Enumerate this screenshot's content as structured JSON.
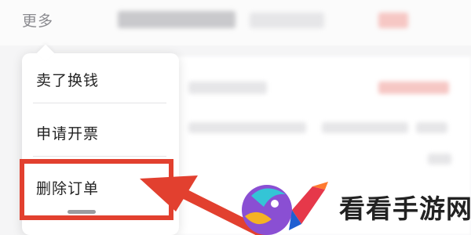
{
  "header": {
    "more_label": "更多"
  },
  "popup_menu": {
    "items": [
      {
        "label": "卖了换钱"
      },
      {
        "label": "申请开票"
      },
      {
        "label": "删除订单",
        "highlighted": true
      }
    ]
  },
  "annotation": {
    "highlight_color": "#e2402f",
    "arrow_color": "#e2402f"
  },
  "watermark": {
    "text": "看看手游网",
    "logo": "kankan-logo"
  }
}
